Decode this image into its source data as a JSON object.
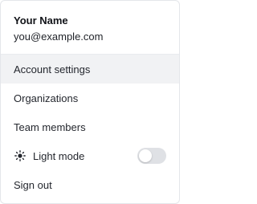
{
  "user": {
    "name": "Your Name",
    "email": "you@example.com"
  },
  "menu": {
    "items": [
      {
        "label": "Account settings"
      },
      {
        "label": "Organizations"
      },
      {
        "label": "Team members"
      }
    ],
    "theme": {
      "label": "Light mode",
      "icon": "sun-icon",
      "dark_mode_enabled": false
    },
    "sign_out_label": "Sign out"
  },
  "colors": {
    "hover_bg": "#f1f2f4",
    "border": "#e4e6ea",
    "toggle_off": "#dfe1e5"
  }
}
